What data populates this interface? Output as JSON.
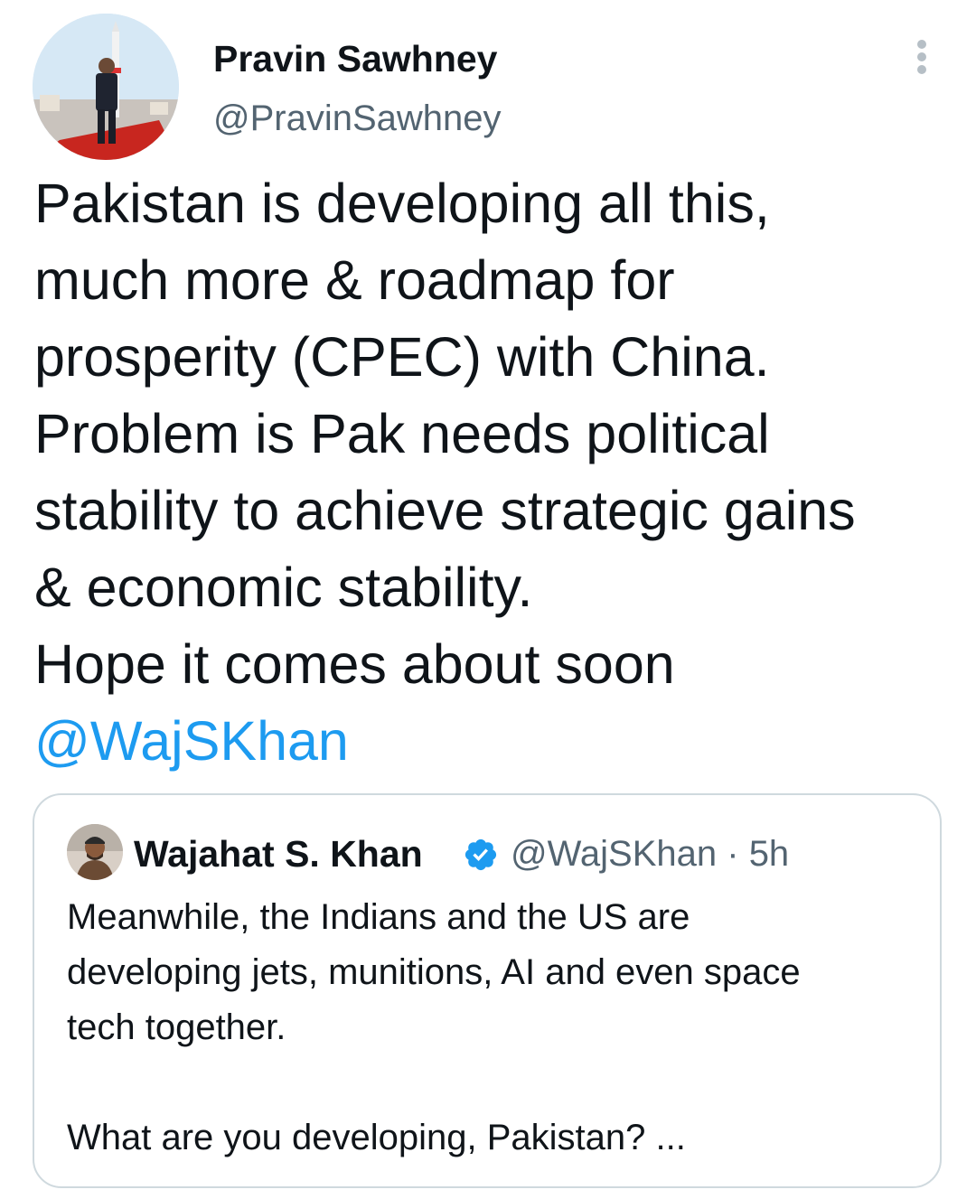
{
  "author": {
    "name": "Pravin Sawhney",
    "handle": "@PravinSawhney"
  },
  "tweet": {
    "lines": [
      "Pakistan is developing all this,",
      "much more & roadmap for",
      "prosperity (CPEC) with China.",
      "Problem is Pak needs political",
      "stability to achieve strategic gains",
      "& economic stability.",
      "Hope it comes about soon"
    ],
    "mention": "@WajSKhan"
  },
  "quoted": {
    "name": "Wajahat S. Khan",
    "handle": "@WajSKhan",
    "separator": "·",
    "time": "5h",
    "lines": [
      "Meanwhile, the Indians and the US are",
      "developing jets, munitions, AI and even space",
      "tech together.",
      "",
      "What are you developing, Pakistan? ..."
    ]
  },
  "colors": {
    "link": "#1d9bf0",
    "verified": "#1d9bf0",
    "secondary_text": "#536471",
    "border": "#cfd9de"
  },
  "icons": {
    "more": "more-vertical-icon",
    "verified": "verified-badge-icon"
  }
}
